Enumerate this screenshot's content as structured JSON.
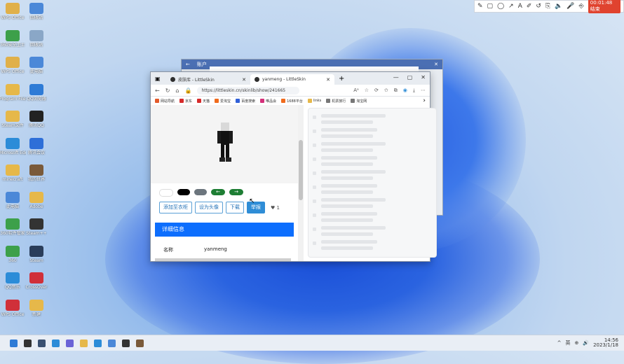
{
  "screen_toolbar": {
    "tools": [
      "✎",
      "▢",
      "◯",
      "↗",
      "A",
      "✐",
      "↺",
      "⎘",
      "🔈",
      "🎤",
      "⎆"
    ],
    "rec_label": "00:01:48 结束"
  },
  "desktop_icons": [
    {
      "label": "WPS Office",
      "color": "#e0b04a"
    },
    {
      "label": "回收站",
      "color": "#4b88d8"
    },
    {
      "label": "360安全卫士",
      "color": "#3da04a"
    },
    {
      "label": "回收站",
      "color": "#8aa7c7"
    },
    {
      "label": "WPS Office",
      "color": "#e0b04a"
    },
    {
      "label": "此电脑",
      "color": "#4b88d8"
    },
    {
      "label": "Program Files",
      "color": "#e6b84a"
    },
    {
      "label": "QQ浏览器",
      "color": "#2e7bd6"
    },
    {
      "label": "Steam文件",
      "color": "#e6b84a"
    },
    {
      "label": "腾讯QQ",
      "color": "#222222"
    },
    {
      "label": "Microsoft Edge",
      "color": "#2c8cd8"
    },
    {
      "label": "腾讯会议",
      "color": "#2e6fd8"
    },
    {
      "label": "minecraft",
      "color": "#e6b84a"
    },
    {
      "label": "我的世界",
      "color": "#7a5a3a"
    },
    {
      "label": "此电脑",
      "color": "#4b88d8"
    },
    {
      "label": "Adobe",
      "color": "#e6b84a"
    },
    {
      "label": "360软件管家",
      "color": "#3da04a"
    },
    {
      "label": "Steam++",
      "color": "#333333"
    },
    {
      "label": "360",
      "color": "#3da04a"
    },
    {
      "label": "Steam",
      "color": "#2a3d5a"
    },
    {
      "label": "QQ音乐",
      "color": "#2c8cd8"
    },
    {
      "label": "CrossOver",
      "color": "#d0303a"
    },
    {
      "label": "WPS Office",
      "color": "#d0303a"
    },
    {
      "label": "新建",
      "color": "#e6b84a"
    }
  ],
  "bg_window": {
    "title": "账户"
  },
  "browser": {
    "tabs": [
      {
        "label": "皮肤库 - LittleSkin",
        "active": false
      },
      {
        "label": "yanmeng - LittleSkin",
        "active": true
      }
    ],
    "new_tab": "+",
    "controls": [
      "—",
      "▢",
      "✕"
    ],
    "url": "https://littleskin.cn/skinlib/show/241665",
    "nav": {
      "back": "←",
      "refresh": "↻",
      "home": "⌂"
    },
    "bookmarks": [
      {
        "label": "网站导航",
        "color": "#e35a2a"
      },
      {
        "label": "京东",
        "color": "#d62b2b"
      },
      {
        "label": "天猫",
        "color": "#d62b2b"
      },
      {
        "label": "爱淘宝",
        "color": "#f06b1d"
      },
      {
        "label": "百度搜索",
        "color": "#3060d8"
      },
      {
        "label": "唯品会",
        "color": "#d4307a"
      },
      {
        "label": "1688平台",
        "color": "#f06b1d"
      },
      {
        "label": "links",
        "color": "#e6b84a"
      },
      {
        "label": "机票旅行",
        "color": "#777777"
      },
      {
        "label": "淘宝网",
        "color": "#777777"
      }
    ],
    "buttons": {
      "add_wardrobe": "添加至衣柜",
      "set_avatar": "设为头像",
      "download": "下载",
      "report": "举报",
      "likes": "♥ 1"
    },
    "detail_header": "详细信息",
    "detail_row": {
      "key": "名称",
      "value": "yanmeng"
    }
  },
  "taskbar": {
    "icons": [
      {
        "name": "start",
        "color": "#2e7bd6"
      },
      {
        "name": "search",
        "color": "#333333"
      },
      {
        "name": "taskview",
        "color": "#3a5070"
      },
      {
        "name": "widgets",
        "color": "#2c8cd8"
      },
      {
        "name": "chat",
        "color": "#6b63d6"
      },
      {
        "name": "explorer",
        "color": "#e6b84a"
      },
      {
        "name": "edge",
        "color": "#2c8cd8"
      },
      {
        "name": "store",
        "color": "#4b88d8"
      },
      {
        "name": "qq",
        "color": "#333333"
      },
      {
        "name": "minecraft",
        "color": "#7a5a3a"
      }
    ],
    "tray": [
      "^",
      "英",
      "⊕",
      "🔊"
    ],
    "time": "14:56",
    "date": "2023/1/18"
  }
}
